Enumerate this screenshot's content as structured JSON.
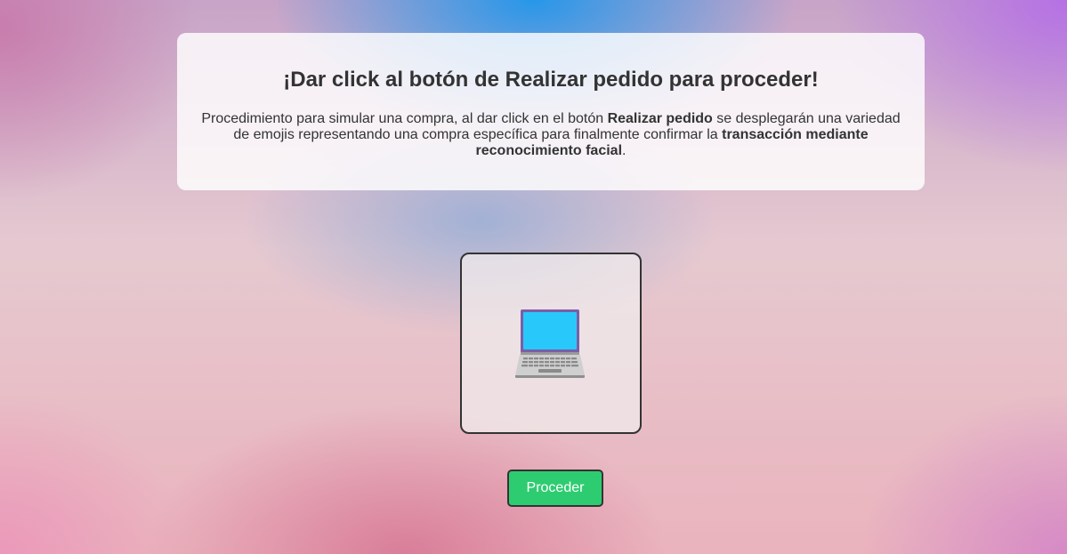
{
  "card": {
    "title": "¡Dar click al botón de Realizar pedido para proceder!",
    "description": {
      "part1": "Procedimiento para simular una compra, al dar click en el botón ",
      "bold1": "Realizar pedido",
      "part2": " se desplegarán una variedad de emojis representando una compra específica para finalmente confirmar la ",
      "bold2": "transacción mediante reconocimiento facial",
      "part3": "."
    }
  },
  "emoji_display": {
    "icon": "laptop-icon",
    "colors": {
      "frame": "#7b5ea7",
      "screen": "#29c8fb",
      "keyboard": "#c9c9c9"
    }
  },
  "actions": {
    "proceed_label": "Proceder"
  },
  "colors": {
    "button_bg": "#2ecc71",
    "text": "#333333"
  }
}
